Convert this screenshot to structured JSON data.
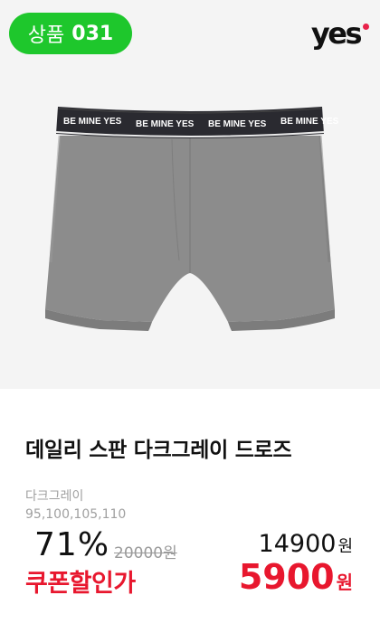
{
  "badge": {
    "label": "상품",
    "number": "031",
    "color": "#1ec72c"
  },
  "brand": {
    "logo_text": "yes",
    "dot_color": "#e8224a"
  },
  "product": {
    "image_icon": "boxer-briefs-image",
    "waistband_text": [
      "BE MINE YES",
      "BE MINE YES",
      "BE MINE YES",
      "BE MINE YES"
    ],
    "title": "데일리 스판 다크그레이 드로즈",
    "color": "다크그레이",
    "sizes": "95,100,105,110"
  },
  "pricing": {
    "discount": "71",
    "discount_unit": "%",
    "original_price": "20000원",
    "price": "14900",
    "price_unit": "원",
    "coupon_label": "쿠폰할인가",
    "coupon_price": "5900",
    "coupon_unit": "원",
    "accent_color": "#e8172e"
  }
}
